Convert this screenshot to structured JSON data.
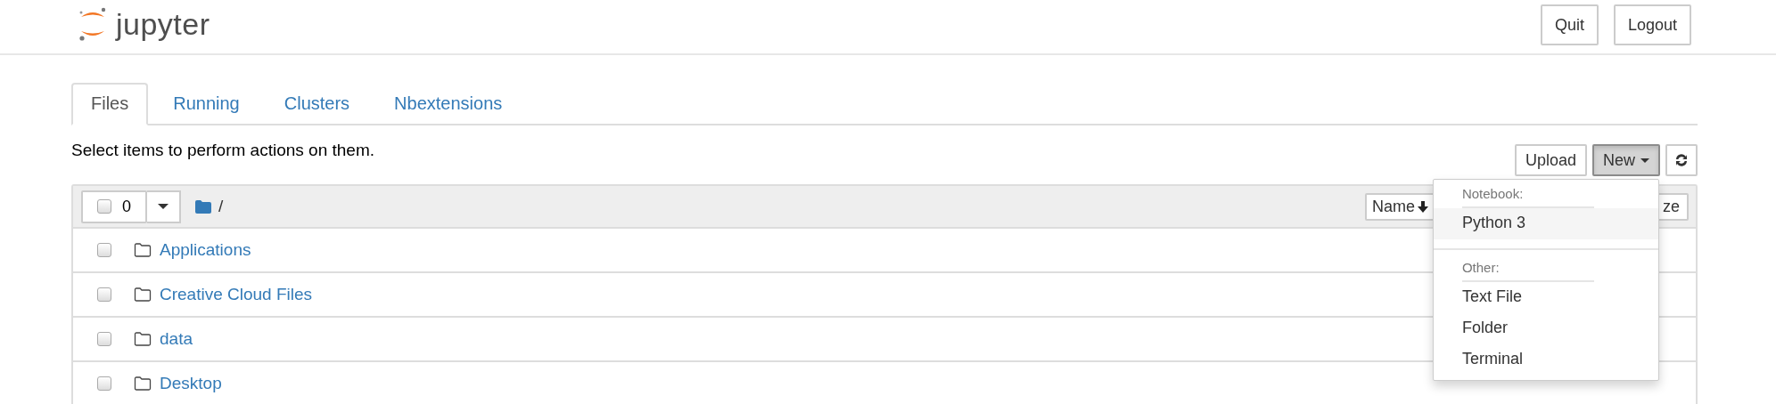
{
  "header": {
    "logo_text": "jupyter",
    "buttons": [
      "Quit",
      "Logout"
    ]
  },
  "tabs": [
    {
      "label": "Files",
      "selected": true
    },
    {
      "label": "Running",
      "selected": false
    },
    {
      "label": "Clusters",
      "selected": false
    },
    {
      "label": "Nbextensions",
      "selected": false
    }
  ],
  "hint": "Select items to perform actions on them.",
  "toolbar": {
    "upload": "Upload",
    "new": {
      "label": "New",
      "expanded": true
    }
  },
  "list_header": {
    "selected_count": "0",
    "checked": false,
    "path": "/",
    "sort_button": "Name",
    "size_button": "ze"
  },
  "rows": [
    {
      "name": "Applications",
      "checked": false
    },
    {
      "name": "Creative Cloud Files",
      "checked": false
    },
    {
      "name": "data",
      "checked": false
    },
    {
      "name": "Desktop",
      "checked": false
    }
  ],
  "new_menu": [
    {
      "kind": "header",
      "label": "Notebook:"
    },
    {
      "kind": "item",
      "label": "Python 3",
      "selected": true
    },
    {
      "kind": "divider"
    },
    {
      "kind": "header",
      "label": "Other:"
    },
    {
      "kind": "item",
      "label": "Text File",
      "selected": false
    },
    {
      "kind": "item",
      "label": "Folder",
      "selected": false
    },
    {
      "kind": "item",
      "label": "Terminal",
      "selected": false
    }
  ]
}
